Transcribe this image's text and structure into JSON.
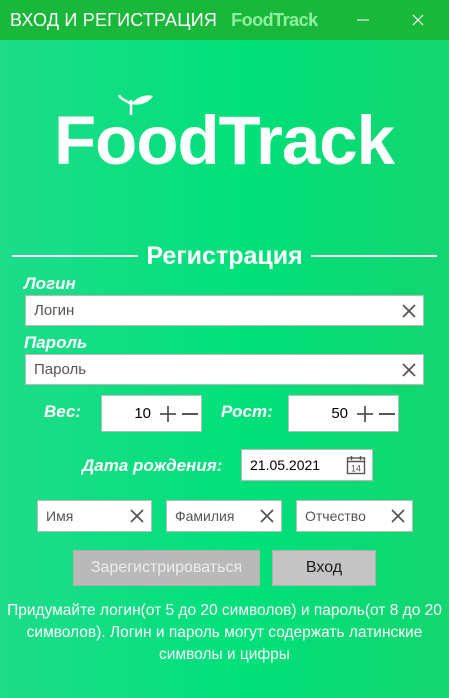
{
  "window": {
    "title": "ВХОД И РЕГИСТРАЦИЯ",
    "brand": "FoodTrack",
    "minimize_icon": "minimize-icon",
    "close_icon": "close-icon"
  },
  "logo": {
    "text": "FoodTrack",
    "icon": "sprout-icon"
  },
  "section": {
    "title": "Регистрация"
  },
  "login": {
    "label": "Логин",
    "placeholder": "Логин",
    "value": ""
  },
  "password": {
    "label": "Пароль",
    "placeholder": "Пароль",
    "value": ""
  },
  "weight": {
    "label": "Вес:",
    "value": "10"
  },
  "height": {
    "label": "Рост:",
    "value": "50"
  },
  "birth_date": {
    "label": "Дата рождения:",
    "value": "21.05.2021",
    "icon": "calendar-icon",
    "calendar_day": "14"
  },
  "first_name": {
    "placeholder": "Имя",
    "value": ""
  },
  "last_name": {
    "placeholder": "Фамилия",
    "value": ""
  },
  "patronymic": {
    "placeholder": "Отчество",
    "value": ""
  },
  "buttons": {
    "register": "Зарегистрироваться",
    "login": "Вход"
  },
  "hint": "Придумайте логин(от 5 до 20 символов) и пароль(от 8 до 20 символов). Логин и пароль могут содержать латинские символы и цифры",
  "colors": {
    "background": "#00e07a",
    "titlebar": "#1ab83a",
    "brand_accent": "#8ff0a0",
    "register_button": "#b9b9b9",
    "login_button": "#c4c4c4"
  }
}
